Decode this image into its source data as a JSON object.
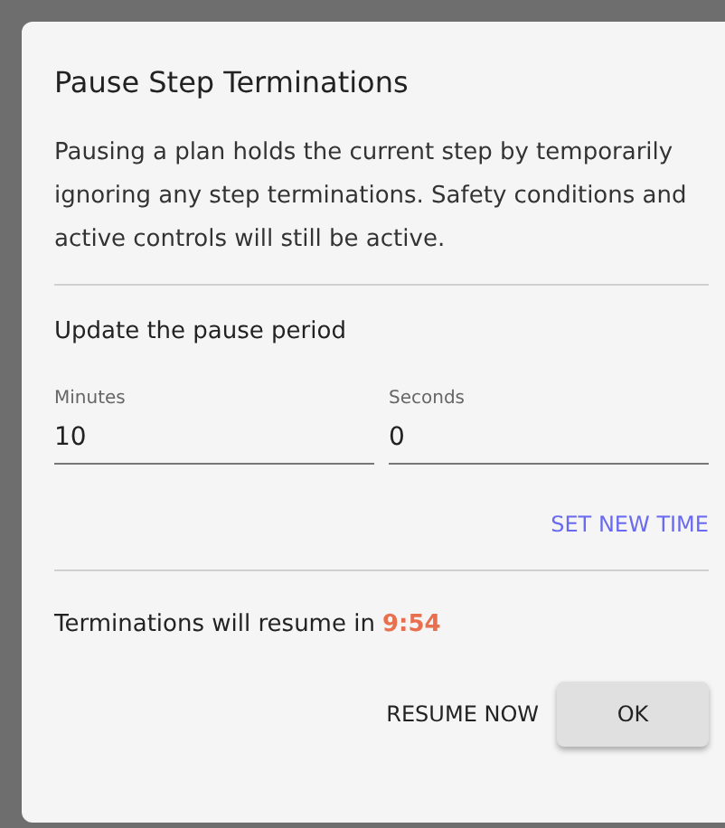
{
  "dialog": {
    "title": "Pause Step Terminations",
    "description": "Pausing a plan holds the current step by temporarily ignoring any step terminations. Safety conditions and active controls will still be active.",
    "section_title": "Update the pause period",
    "fields": [
      {
        "label": "Minutes",
        "value": "10"
      },
      {
        "label": "Seconds",
        "value": "0"
      }
    ],
    "set_button": "SET NEW TIME",
    "status": {
      "text": "Terminations will resume in",
      "countdown": "9:54"
    },
    "buttons": [
      {
        "label": "RESUME NOW",
        "kind": "text"
      },
      {
        "label": "OK",
        "kind": "raised"
      }
    ]
  }
}
